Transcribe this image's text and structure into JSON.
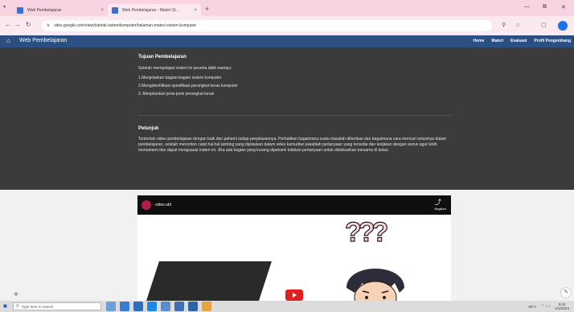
{
  "browser": {
    "tab_dropdown": "▾",
    "tabs": [
      {
        "title": "Web Pembelajaran",
        "close": "×"
      },
      {
        "title": "Web Pembelajaran - Materi Si…",
        "close": "×"
      }
    ],
    "new_tab": "+",
    "window_controls": {
      "minimize": "—",
      "restore": "⧉",
      "close": "✕"
    },
    "nav": {
      "back": "←",
      "forward": "→",
      "reload": "↻",
      "site_info": "⇅"
    },
    "url": "sites.google.com/view/tutorial-sistemkomputer/halaman-materi-sistem-komputer",
    "toolbar_icons": {
      "zoom": "⚲",
      "bookmark": "☆",
      "sidepanel": "▢"
    }
  },
  "site": {
    "home_icon": "⌂",
    "brand": "Web Pembelajaran",
    "menu": [
      "Home",
      "Materi",
      "Evaluasi",
      "Profil Pengembang"
    ]
  },
  "content": {
    "objectives_title": "Tujuan Pembelajaran",
    "objectives_intro": "Setelah mempelajari materi ini peserta didik mampu:",
    "objectives": [
      "1.Menjelaskan bagian-bagian sistem komputer",
      "2.Mengidentifikasi spesifikasi perangkat keras komputer",
      "3. Menjelaskan jenis-jenis perangkat lunak"
    ],
    "instructions_title": "Petunjuk",
    "instructions_text": "Tontonlah video pembelajaran dengan baik dan pahami setiap penjelasannya. Perhatikan bagaimana suatu masalah diberikan dan bagaimana cara mencari solusinya dalam pembelajaran, setelah menonton catat hal-hal penting yang dijelaskan dalam video kemudian jawablah pertanyaan yang tersedia dan kerjakan dengan serius agar lebih memahami dan dapat menguasai materi ini. Jika ada bagian yang kurang dipahami tuliskan pertanyaan untuk didiskusikan bersama di kelas."
  },
  "video": {
    "channel_title": "video.sbt",
    "share_label": "Bagikan",
    "share_icon": "⤴",
    "question_marks": "???"
  },
  "page_icons": {
    "settings": "✱",
    "edit": "✎"
  },
  "taskbar": {
    "start": "■",
    "search_placeholder": "Type here to search",
    "weather": "29°C",
    "clock_time": "9:41",
    "clock_date": "1/1/2024"
  },
  "colors": {
    "tabstrip": "#f8d3e2",
    "site_nav": "#2b4e83",
    "content_bg": "#3b3b3b",
    "play_button": "#e02020"
  }
}
